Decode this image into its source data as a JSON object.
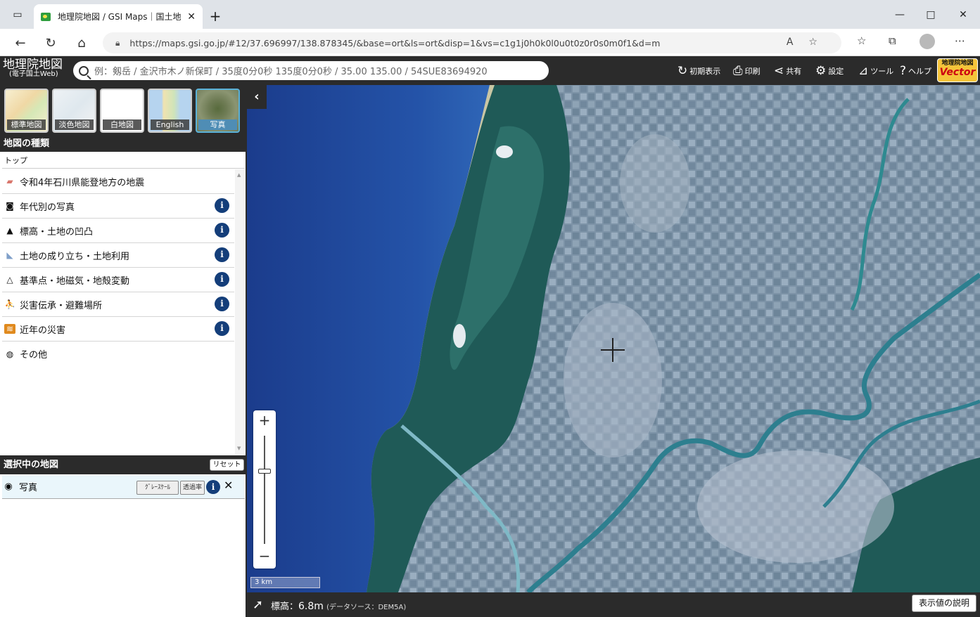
{
  "browser": {
    "tab_title": "地理院地図 / GSI Maps｜国土地",
    "tab_close": "✕",
    "new_tab": "+",
    "url": "https://maps.gsi.go.jp/#12/37.696997/138.878345/&base=ort&ls=ort&disp=1&vs=c1g1j0h0k0l0u0t0z0r0s0m0f1&d=m"
  },
  "header": {
    "logo_main": "地理院地図",
    "logo_sub": "(電子国土Web)",
    "search_placeholder": "例：剱岳 / 金沢市木ノ新保町 / 35度0分0秒 135度0分0秒 / 35.00 135.00 / 54SUE83694920",
    "buttons": {
      "initial": "初期表示",
      "print": "印刷",
      "share": "共有",
      "settings": "設定",
      "tools": "ツール",
      "help": "ヘルプ"
    },
    "vector_badge_top": "地理院地図",
    "vector_badge_bottom": "Vector"
  },
  "base_maps": [
    {
      "label": "標準地図"
    },
    {
      "label": "淡色地図"
    },
    {
      "label": "白地図"
    },
    {
      "label": "English"
    },
    {
      "label": "写真"
    }
  ],
  "map_types": {
    "title": "地図の種類",
    "breadcrumb": "トップ",
    "items": [
      {
        "label": "令和4年石川県能登地方の地震",
        "icon": "folder-icon",
        "info": false
      },
      {
        "label": "年代別の写真",
        "icon": "camera-icon",
        "info": true
      },
      {
        "label": "標高・土地の凹凸",
        "icon": "mountain-icon",
        "info": true
      },
      {
        "label": "土地の成り立ち・土地利用",
        "icon": "land-icon",
        "info": true
      },
      {
        "label": "基準点・地磁気・地殻変動",
        "icon": "triangle-icon",
        "info": true
      },
      {
        "label": "災害伝承・避難場所",
        "icon": "evacuation-icon",
        "info": true
      },
      {
        "label": "近年の災害",
        "icon": "disaster-icon",
        "info": true
      },
      {
        "label": "その他",
        "icon": "globe-icon",
        "info": false
      }
    ],
    "info_glyph": "i"
  },
  "selected": {
    "title": "選択中の地図",
    "reset_label": "リセット",
    "layer_name": "写真",
    "grayscale_label": "ｸﾞﾚｰｽｹｰﾙ",
    "opacity_label": "透過率",
    "close_glyph": "✕"
  },
  "map": {
    "scale_label": "3 km",
    "zoom_in": "+",
    "zoom_out": "−",
    "zoom_level_fraction": 0.33
  },
  "footer": {
    "elevation_label": "標高：",
    "elevation_value": "6.8m",
    "data_source": "(データソース：DEM5A)",
    "explain_button": "表示値の説明"
  }
}
